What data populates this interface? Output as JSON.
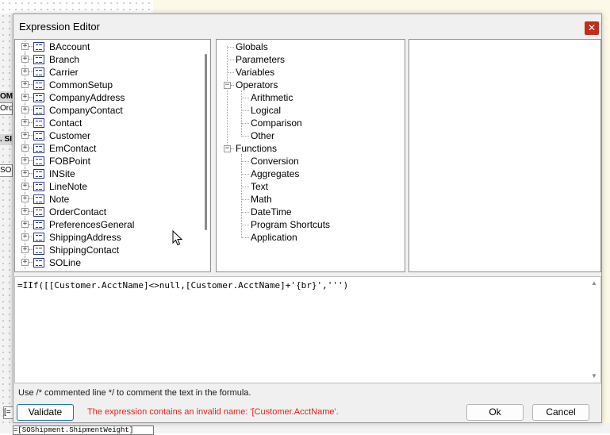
{
  "background": {
    "side_labels": [
      "OM",
      "Ord",
      ". SI",
      "SO"
    ],
    "bottom_field": "=[SOShipment.ShipmentWeight]",
    "bottom_left_label": "[="
  },
  "dialog": {
    "title": "Expression Editor",
    "close_icon": "close-icon"
  },
  "objects_tree": {
    "items": [
      "BAccount",
      "Branch",
      "Carrier",
      "CommonSetup",
      "CompanyAddress",
      "CompanyContact",
      "Contact",
      "Customer",
      "EmContact",
      "FOBPoint",
      "INSite",
      "LineNote",
      "Note",
      "OrderContact",
      "PreferencesGeneral",
      "ShippingAddress",
      "ShippingContact",
      "SOLine"
    ],
    "expander_glyph": "+"
  },
  "functions_tree": {
    "root_items": [
      "Globals",
      "Parameters",
      "Variables"
    ],
    "operators": {
      "label": "Operators",
      "expander_glyph": "−",
      "children": [
        "Arithmetic",
        "Logical",
        "Comparison",
        "Other"
      ]
    },
    "functions": {
      "label": "Functions",
      "expander_glyph": "−",
      "children": [
        "Conversion",
        "Aggregates",
        "Text",
        "Math",
        "DateTime",
        "Program Shortcuts",
        "Application"
      ]
    }
  },
  "editor": {
    "expression": "=IIf([[Customer.AcctName]<>null,[Customer.AcctName]+'{br}',''')",
    "scroll_up_glyph": "▲",
    "scroll_down_glyph": "▼"
  },
  "hint": "Use /* commented line */ to comment the text in the formula.",
  "validate_label": "Validate",
  "error_message": "The expression contains an invalid name: '[Customer.AcctName'.",
  "ok_label": "Ok",
  "cancel_label": "Cancel",
  "colors": {
    "error": "#e2231a",
    "close_button": "#c42b1c",
    "validate_border": "#1f6fc4"
  }
}
